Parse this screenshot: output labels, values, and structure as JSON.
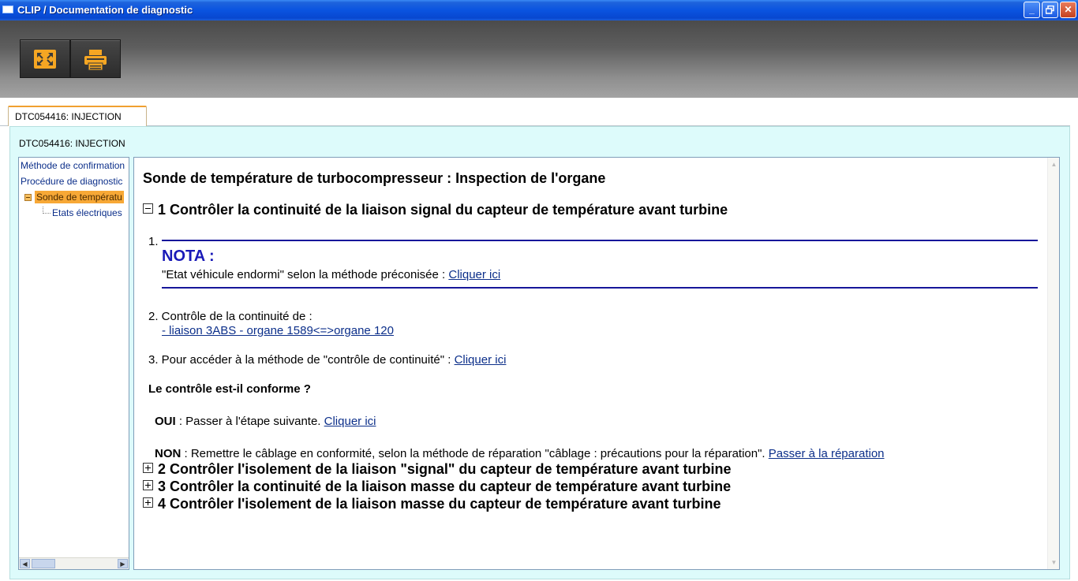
{
  "window": {
    "title": "CLIP / Documentation de diagnostic",
    "minimize": "_",
    "close": "✕"
  },
  "toolbar": {
    "fullscreen_icon": "fullscreen-icon",
    "print_icon": "printer-icon",
    "accent": "#f5a623"
  },
  "tab": {
    "label": "DTC054416: INJECTION"
  },
  "panel": {
    "title": "DTC054416: INJECTION"
  },
  "tree": {
    "items": [
      {
        "label": "Méthode de confirmation"
      },
      {
        "label": "Procédure de diagnostic"
      },
      {
        "label": "Sonde de températu"
      },
      {
        "label": "Etats électriques"
      }
    ],
    "scroll_left": "◀",
    "scroll_right": "▶"
  },
  "content": {
    "title": "Sonde de température de turbocompresseur : Inspection de l'organe",
    "step1": {
      "label": "1 Contrôler la continuité de la liaison signal du capteur de température avant turbine",
      "item1_num": "1.",
      "nota_title": "NOTA :",
      "nota_text": "\"Etat véhicule endormi\" selon la méthode préconisée : ",
      "nota_link": "Cliquer ici",
      "item2_text": "2. Contrôle de la continuité de  :",
      "item2_link": "- liaison 3ABS - organe 1589<=>organe 120",
      "item3_text": "3. Pour accéder à la méthode de \"contrôle de continuité\" : ",
      "item3_link": "Cliquer ici",
      "question": "Le contrôle est-il conforme ?",
      "oui_label": "OUI",
      "oui_text": " : Passer à l'étape suivante. ",
      "oui_link": "Cliquer ici",
      "non_label": "NON",
      "non_text": " : Remettre le câblage en conformité, selon la méthode de réparation \"câblage : précautions pour la réparation\". ",
      "non_link": "Passer à la réparation"
    },
    "step2": {
      "label": "2 Contrôler l'isolement de la liaison \"signal\" du capteur de température avant turbine"
    },
    "step3": {
      "label": "3 Contrôler la continuité de la liaison masse du capteur de température avant turbine"
    },
    "step4": {
      "label": "4 Contrôler l'isolement de la liaison masse du capteur de température avant turbine"
    },
    "scroll_up": "▲",
    "scroll_down": "▼"
  }
}
